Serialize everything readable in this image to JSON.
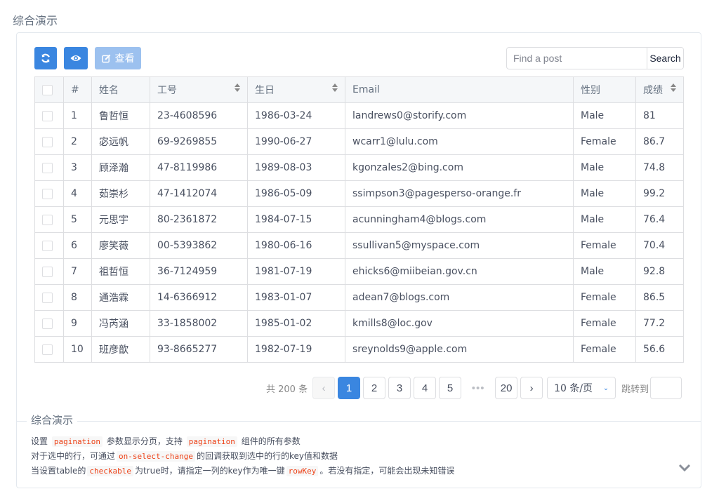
{
  "page": {
    "title": "综合演示"
  },
  "toolbar": {
    "refresh_icon": "refresh-icon",
    "eye_icon": "eye-icon",
    "view_button": {
      "icon": "edit-icon",
      "label": "查看",
      "disabled": true
    },
    "search": {
      "placeholder": "Find a post",
      "value": "",
      "button_label": "Search"
    }
  },
  "table": {
    "columns": [
      {
        "key": "select",
        "label": ""
      },
      {
        "key": "index",
        "label": "#"
      },
      {
        "key": "name",
        "label": "姓名"
      },
      {
        "key": "id",
        "label": "工号",
        "sortable": true
      },
      {
        "key": "birthday",
        "label": "生日",
        "sortable": true
      },
      {
        "key": "email",
        "label": "Email"
      },
      {
        "key": "gender",
        "label": "性别"
      },
      {
        "key": "score",
        "label": "成绩",
        "sortable": true
      }
    ],
    "rows": [
      {
        "index": "1",
        "name": "鲁哲恒",
        "id": "23-4608596",
        "birthday": "1986-03-24",
        "email": "landrews0@storify.com",
        "gender": "Male",
        "score": "81"
      },
      {
        "index": "2",
        "name": "宓远帆",
        "id": "69-9269855",
        "birthday": "1990-06-27",
        "email": "wcarr1@lulu.com",
        "gender": "Female",
        "score": "86.7"
      },
      {
        "index": "3",
        "name": "顾泽瀚",
        "id": "47-8119986",
        "birthday": "1989-08-03",
        "email": "kgonzales2@bing.com",
        "gender": "Male",
        "score": "74.8"
      },
      {
        "index": "4",
        "name": "茹崇杉",
        "id": "47-1412074",
        "birthday": "1986-05-09",
        "email": "ssimpson3@pagesperso-orange.fr",
        "gender": "Male",
        "score": "99.2"
      },
      {
        "index": "5",
        "name": "元思宇",
        "id": "80-2361872",
        "birthday": "1984-07-15",
        "email": "acunningham4@blogs.com",
        "gender": "Male",
        "score": "76.4"
      },
      {
        "index": "6",
        "name": "廖笑薇",
        "id": "00-5393862",
        "birthday": "1980-06-16",
        "email": "ssullivan5@myspace.com",
        "gender": "Female",
        "score": "70.4"
      },
      {
        "index": "7",
        "name": "祖哲恒",
        "id": "36-7124959",
        "birthday": "1981-07-19",
        "email": "ehicks6@miibeian.gov.cn",
        "gender": "Male",
        "score": "92.8"
      },
      {
        "index": "8",
        "name": "通浩霖",
        "id": "14-6366912",
        "birthday": "1983-01-07",
        "email": "adean7@blogs.com",
        "gender": "Female",
        "score": "86.5"
      },
      {
        "index": "9",
        "name": "冯芮涵",
        "id": "33-1858002",
        "birthday": "1985-01-02",
        "email": "kmills8@loc.gov",
        "gender": "Female",
        "score": "77.2"
      },
      {
        "index": "10",
        "name": "班彦歆",
        "id": "93-8665277",
        "birthday": "1982-07-19",
        "email": "sreynolds9@apple.com",
        "gender": "Female",
        "score": "56.6"
      }
    ]
  },
  "pagination": {
    "total_label": "共 200 条",
    "prev": "‹",
    "pages": [
      "1",
      "2",
      "3",
      "4",
      "5"
    ],
    "current": "1",
    "ellipsis": "•••",
    "last": "20",
    "next": "›",
    "page_size": "10 条/页",
    "jump_label": "跳转到",
    "jump_value": ""
  },
  "description": {
    "title": "综合演示",
    "lines": [
      [
        {
          "t": "设置 "
        },
        {
          "code": "pagination"
        },
        {
          "t": " 参数显示分页，支持 "
        },
        {
          "code": "pagination"
        },
        {
          "t": " 组件的所有参数"
        }
      ],
      [
        {
          "t": "对于选中的行，可通过"
        },
        {
          "code": "on-select-change"
        },
        {
          "t": "的回调获取到选中的行的key值和数据"
        }
      ],
      [
        {
          "t": "当设置table的"
        },
        {
          "code": "checkable"
        },
        {
          "t": "为true时，请指定一列的key作为唯一键"
        },
        {
          "code": "rowKey"
        },
        {
          "t": "。若没有指定，可能会出现未知错误"
        }
      ]
    ],
    "expand_icon": "chevron-down-icon"
  }
}
